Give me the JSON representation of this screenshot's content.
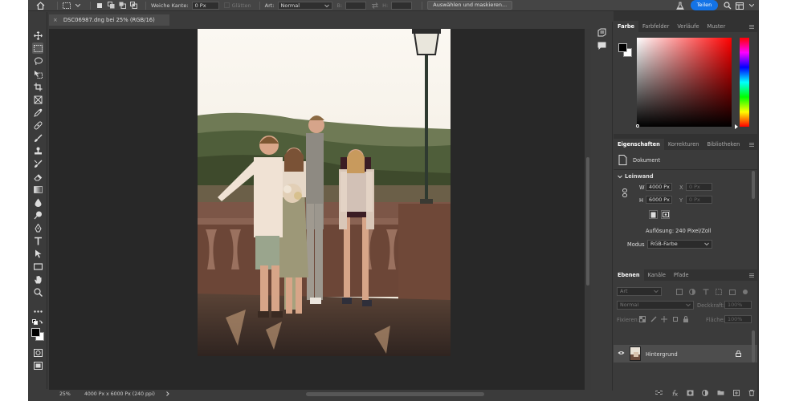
{
  "options_bar": {
    "feather_label": "Weiche Kante:",
    "feather_value": "0 Px",
    "antialias_label": "Glätten",
    "style_label": "Art:",
    "style_value": "Normal",
    "width_label": "B:",
    "height_label": "H:",
    "select_mask_button": "Auswählen und maskieren...",
    "share_button": "Teilen"
  },
  "document_tab": {
    "close": "×",
    "title": "DSC06987.dng bei 25% (RGB/16)"
  },
  "status_bar": {
    "zoom": "25%",
    "doc_info": "4000 Px x 6000 Px (240 ppi)"
  },
  "color_panel": {
    "tabs": [
      "Farbe",
      "Farbfelder",
      "Verläufe",
      "Muster"
    ],
    "active_tab": "Farbe",
    "foreground_color": "#000000",
    "background_color": "#ffffff"
  },
  "properties_panel": {
    "tabs": [
      "Eigenschaften",
      "Korrekturen",
      "Bibliotheken"
    ],
    "active_tab": "Eigenschaften",
    "doc_label": "Dokument",
    "section": "Leinwand",
    "w_label": "W",
    "w_value": "4000 Px",
    "x_label": "X",
    "x_placeholder": "0 Px",
    "h_label": "H",
    "h_value": "6000 Px",
    "y_label": "Y",
    "y_placeholder": "0 Px",
    "resolution": "Auflösung: 240 Pixel/Zoll",
    "mode_label": "Modus",
    "mode_value": "RGB-Farbe"
  },
  "layers_panel": {
    "tabs": [
      "Ebenen",
      "Kanäle",
      "Pfade"
    ],
    "active_tab": "Ebenen",
    "filter_placeholder": "Art",
    "blend_mode": "Normal",
    "opacity_label": "Deckkraft:",
    "opacity_value": "100%",
    "lock_label": "Fixieren:",
    "fill_label": "Fläche:",
    "fill_value": "100%",
    "layers": [
      {
        "name": "Hintergrund",
        "visible": true,
        "locked": true
      }
    ]
  },
  "colors": {
    "app_bg": "#3b3b3b",
    "panel_bg": "#323232",
    "accent": "#1473e6"
  }
}
